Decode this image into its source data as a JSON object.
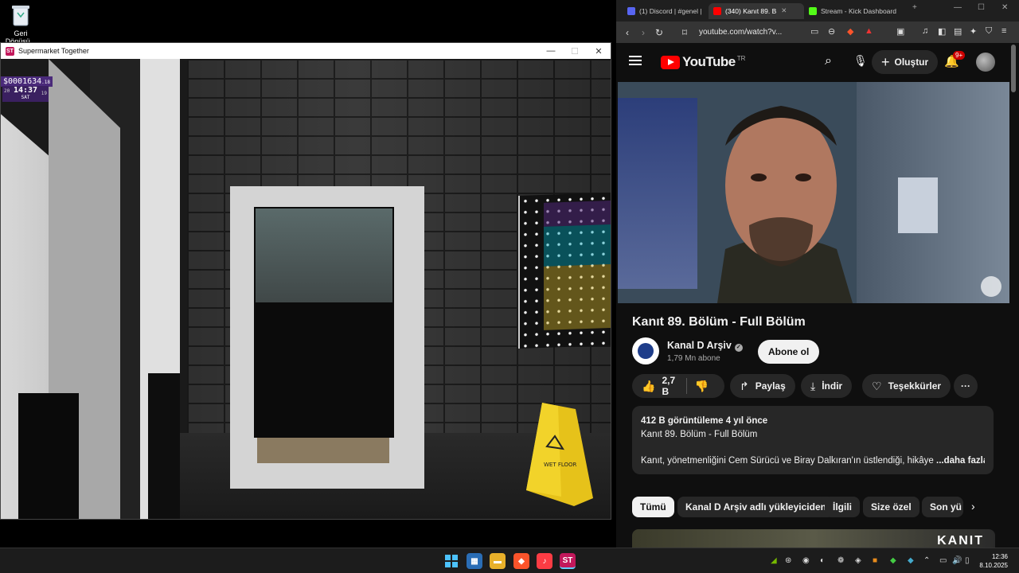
{
  "desktop": {
    "recycle_bin_label": "Geri\nDönüşü..."
  },
  "game_window": {
    "title": "Supermarket Together",
    "hud": {
      "money": "$0001634",
      "money_suffix": ".18",
      "time": "14:37",
      "day": "SAT",
      "left_small": "20",
      "right_small": "19"
    },
    "wet_floor_sign_text": "WET FLOOR",
    "controls": {
      "minimize": "—",
      "maximize": "☐",
      "close": "✕"
    }
  },
  "browser": {
    "tabs": [
      {
        "label": "(1) Discord | #genel |",
        "color": "#5865f2",
        "active": false
      },
      {
        "label": "(340) Kanıt 89. B",
        "color": "#ff0000",
        "active": true
      },
      {
        "label": "Stream - Kick Dashboard",
        "color": "#53fc18",
        "active": false
      }
    ],
    "new_tab": "+",
    "url": "youtube.com/watch?v...",
    "youtube": {
      "logo_text": "YouTube",
      "logo_country": "TR",
      "create_label": "Oluştur",
      "notification_count": "9+",
      "video_title": "Kanıt 89. Bölüm - Full Bölüm",
      "channel_name": "Kanal D Arşiv",
      "subscriber_count": "1,79 Mn abone",
      "subscribe_label": "Abone ol",
      "like_count": "2,7 B",
      "share_label": "Paylaş",
      "download_label": "İndir",
      "thanks_label": "Teşekkürler",
      "more_label": "···",
      "description": {
        "meta": "412 B görüntüleme  4 yıl önce",
        "line1": "Kanıt 89. Bölüm - Full Bölüm",
        "line2": "Kanıt, yönetmenliğini Cem Sürücü ve Biray Dalkıran'ın üstlendiği, hikâye",
        "more": "...daha fazla"
      },
      "chips": [
        {
          "label": "Tümü",
          "active": true
        },
        {
          "label": "Kanal D Arşiv adlı yükleyiciden",
          "active": false
        },
        {
          "label": "İlgili",
          "active": false
        },
        {
          "label": "Size özel",
          "active": false
        },
        {
          "label": "Son yü",
          "active": false
        }
      ],
      "rec_thumb_text": "KANIT"
    }
  },
  "taskbar": {
    "time": "12:36",
    "date": "8.10.2025"
  }
}
